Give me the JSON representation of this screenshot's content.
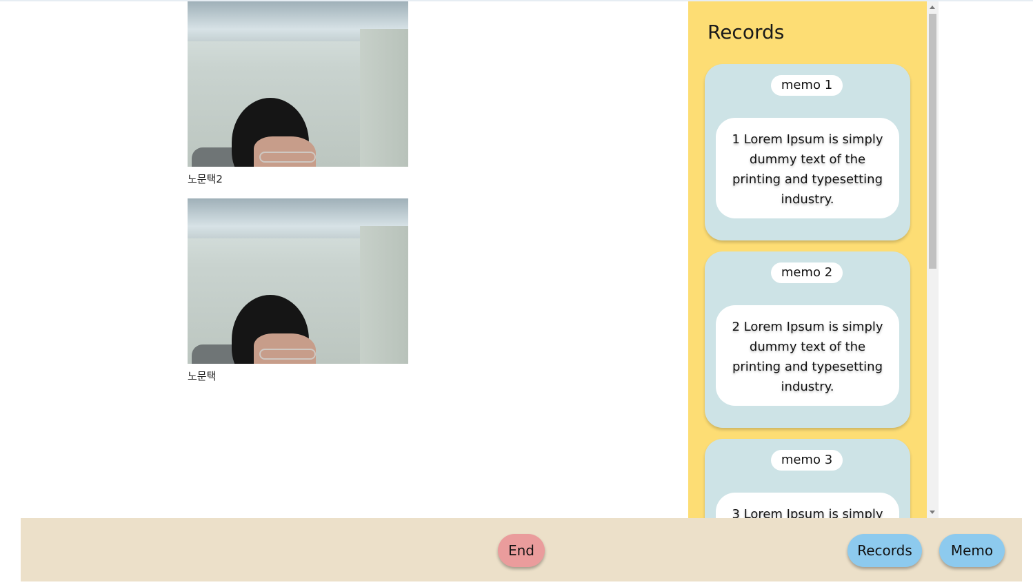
{
  "participants": [
    {
      "name": "노문택2"
    },
    {
      "name": "노문택"
    }
  ],
  "records": {
    "title": "Records",
    "memos": [
      {
        "tag": "memo 1",
        "text": "1 Lorem Ipsum is simply dummy text of the printing and typesetting industry."
      },
      {
        "tag": "memo 2",
        "text": "2 Lorem Ipsum is simply dummy text of the printing and typesetting industry."
      },
      {
        "tag": "memo 3",
        "text": "3 Lorem Ipsum is simply"
      }
    ]
  },
  "controls": {
    "end_label": "End",
    "records_label": "Records",
    "memo_label": "Memo"
  },
  "colors": {
    "records_panel_bg": "#fddd74",
    "memo_card_bg": "#cde3e6",
    "bottom_bar_bg": "#ece0c9",
    "end_button": "#ea9c9c",
    "nav_button": "#8dcaee"
  }
}
